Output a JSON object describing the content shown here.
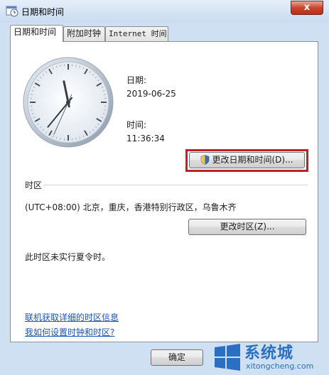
{
  "window": {
    "title": "日期和时间",
    "close_glyph": "x"
  },
  "tabs": [
    {
      "label": "日期和时间",
      "active": true
    },
    {
      "label": "附加时钟",
      "active": false
    },
    {
      "label": "Internet 时间",
      "active": false
    }
  ],
  "date_time": {
    "date_label": "日期:",
    "date_value": "2019-06-25",
    "time_label": "时间:",
    "time_value": "11:36:34",
    "change_button": "更改日期和时间(D)..."
  },
  "timezone": {
    "section_label": "时区",
    "value": "(UTC+08:00) 北京，重庆，香港特别行政区，乌鲁木齐",
    "change_button": "更改时区(Z)...",
    "dst_note": "此时区未实行夏令时。"
  },
  "links": {
    "online_info": "联机获取详细的时区信息",
    "how_to_set": "我如何设置时钟和时区?"
  },
  "footer": {
    "ok_button": "确定"
  },
  "watermark": {
    "brand": "系统城",
    "url": "xitongcheng.com"
  },
  "colors": {
    "highlight": "#c0202a",
    "link": "#1a55b5",
    "titlebar": "#c9dcf1"
  },
  "clock_time": {
    "hour": 11,
    "minute": 36,
    "second": 34
  }
}
